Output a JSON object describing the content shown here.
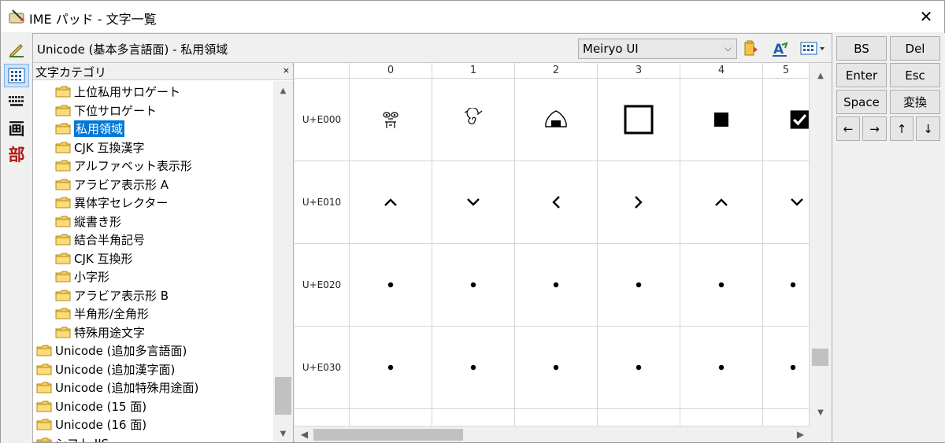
{
  "window": {
    "title": "IME パッド - 文字一覧",
    "close": "✕"
  },
  "left_toolbar": {
    "tools": [
      {
        "name": "handwriting-tool",
        "glyph": "✍",
        "active": false
      },
      {
        "name": "char-list-tool",
        "glyph": "▦",
        "active": true
      },
      {
        "name": "soft-keyboard-tool",
        "glyph": "⌨",
        "active": false
      },
      {
        "name": "stroke-count-tool",
        "glyph": "画",
        "active": false
      },
      {
        "name": "radical-tool",
        "glyph": "部",
        "active": false
      }
    ]
  },
  "header": {
    "title": "Unicode (基本多言語面) - 私用領域",
    "font": "Meiryo UI",
    "font_arrow": "⌵"
  },
  "category": {
    "label": "文字カテゴリ",
    "close": "×",
    "items": [
      {
        "label": "上位私用サロゲート",
        "level": 1,
        "selected": false
      },
      {
        "label": "下位サロゲート",
        "level": 1,
        "selected": false
      },
      {
        "label": "私用領域",
        "level": 1,
        "selected": true
      },
      {
        "label": "CJK 互換漢字",
        "level": 1,
        "selected": false
      },
      {
        "label": "アルファベット表示形",
        "level": 1,
        "selected": false
      },
      {
        "label": "アラビア表示形 A",
        "level": 1,
        "selected": false
      },
      {
        "label": "異体字セレクター",
        "level": 1,
        "selected": false
      },
      {
        "label": "縦書き形",
        "level": 1,
        "selected": false
      },
      {
        "label": "結合半角記号",
        "level": 1,
        "selected": false
      },
      {
        "label": "CJK 互換形",
        "level": 1,
        "selected": false
      },
      {
        "label": "小字形",
        "level": 1,
        "selected": false
      },
      {
        "label": "アラビア表示形 B",
        "level": 1,
        "selected": false
      },
      {
        "label": "半角形/全角形",
        "level": 1,
        "selected": false
      },
      {
        "label": "特殊用途文字",
        "level": 1,
        "selected": false
      },
      {
        "label": "Unicode (追加多言語面)",
        "level": 0,
        "selected": false
      },
      {
        "label": "Unicode (追加漢字面)",
        "level": 0,
        "selected": false
      },
      {
        "label": "Unicode (追加特殊用途面)",
        "level": 0,
        "selected": false
      },
      {
        "label": "Unicode (15 面)",
        "level": 0,
        "selected": false
      },
      {
        "label": "Unicode (16 面)",
        "level": 0,
        "selected": false
      },
      {
        "label": "シフト JIS",
        "level": 0,
        "selected": false
      }
    ]
  },
  "grid": {
    "columns": [
      "0",
      "1",
      "2",
      "3",
      "4",
      "5"
    ],
    "rows": [
      {
        "code": "U+E000",
        "cells": [
          "face",
          "spiral",
          "onigiri",
          "box-empty",
          "box-small",
          "box-check"
        ]
      },
      {
        "code": "U+E010",
        "cells": [
          "^",
          "⌄",
          "<",
          ">",
          "^",
          "⌄"
        ]
      },
      {
        "code": "U+E020",
        "cells": [
          "•",
          "•",
          "•",
          "•",
          "•",
          "•"
        ]
      },
      {
        "code": "U+E030",
        "cells": [
          "•",
          "•",
          "•",
          "•",
          "•",
          "•"
        ]
      }
    ]
  },
  "keys": {
    "bs": "BS",
    "del": "Del",
    "enter": "Enter",
    "esc": "Esc",
    "space": "Space",
    "convert": "変換",
    "left": "←",
    "right": "→",
    "up": "↑",
    "down": "↓"
  }
}
